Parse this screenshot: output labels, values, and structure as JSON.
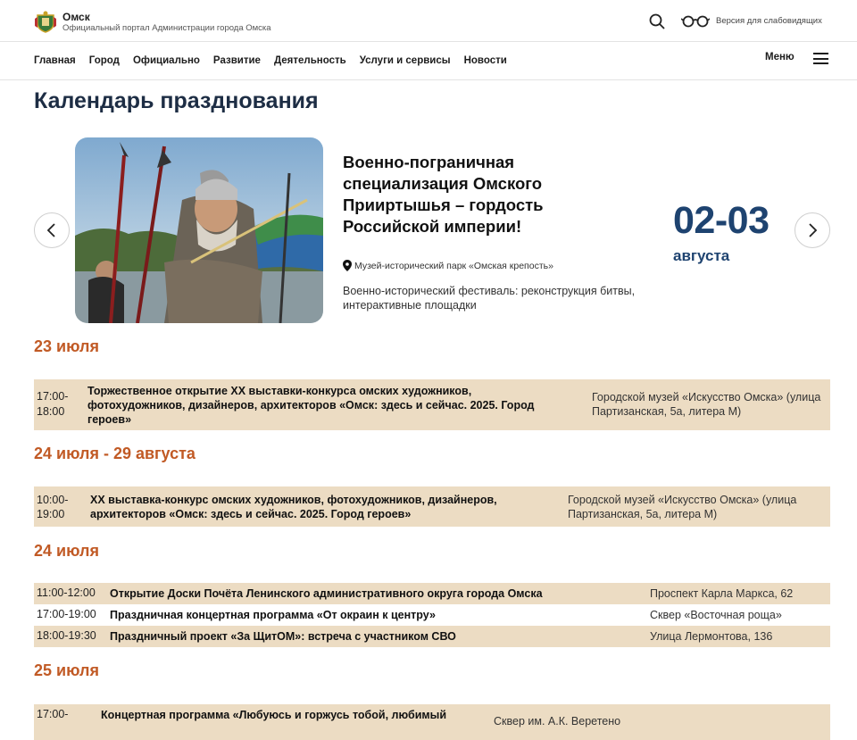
{
  "site": {
    "name": "Омск",
    "subtitle": "Официальный портал Администрации города Омска",
    "vision_link": "Версия для слабовидящих"
  },
  "icons": {
    "logo": "coat-of-arms-icon",
    "search": "search-icon",
    "vision": "glasses-icon",
    "menu": "hamburger-icon",
    "location": "location-pin-icon",
    "prev": "chevron-left-icon",
    "next": "chevron-right-icon"
  },
  "nav": {
    "items": [
      "Главная",
      "Город",
      "Официально",
      "Развитие",
      "Деятельность",
      "Услуги и сервисы",
      "Новости"
    ],
    "menu_label": "Меню"
  },
  "page": {
    "title": "Календарь празднования"
  },
  "featured": {
    "title": "Военно-пограничная специализация Омского Прииртышья – гордость Российской империи!",
    "location": "Музей-исторический парк «Омская крепость»",
    "description": "Военно-исторический фестиваль: реконструкция битвы, интерактивные площадки",
    "date": "02-03",
    "month": "августа"
  },
  "schedule": [
    {
      "date": "23 июля",
      "events": [
        {
          "time_start": "17:00-",
          "time_end": "18:00",
          "name": "Торжественное открытие XX выставки-конкурса омских художников, фотохудожников, дизайнеров, архитекторов «Омск: здесь и сейчас. 2025. Город героев»",
          "place": "Городской музей «Искусство Омска» (улица Партизанская, 5а, литера М)"
        }
      ]
    },
    {
      "date": "24 июля - 29 августа",
      "events": [
        {
          "time_start": "10:00-",
          "time_end": "19:00",
          "name": "XX выставка-конкурс омских художников, фотохудожников, дизайнеров, архитекторов «Омск: здесь и сейчас. 2025. Город героев»",
          "place": "Городской музей «Искусство Омска» (улица Партизанская, 5а, литера М)"
        }
      ]
    },
    {
      "date": "24 июля",
      "events": [
        {
          "time": "11:00-12:00",
          "name": "Открытие Доски Почёта Ленинского административного округа города Омска",
          "place": "Проспект Карла Маркса, 62"
        },
        {
          "time": "17:00-19:00",
          "name": "Праздничная концертная программа «От окраин к центру»",
          "place": "Сквер «Восточная роща»"
        },
        {
          "time": "18:00-19:30",
          "name": "Праздничный проект «За ЩитОМ»: встреча с участником СВО",
          "place": "Улица Лермонтова, 136"
        }
      ]
    },
    {
      "date": "25 июля",
      "events": [
        {
          "time_start": "17:00-",
          "name": "Концертная программа «Любуюсь и горжусь тобой, любимый",
          "place": "Сквер им. А.К. Веретено"
        }
      ]
    }
  ]
}
